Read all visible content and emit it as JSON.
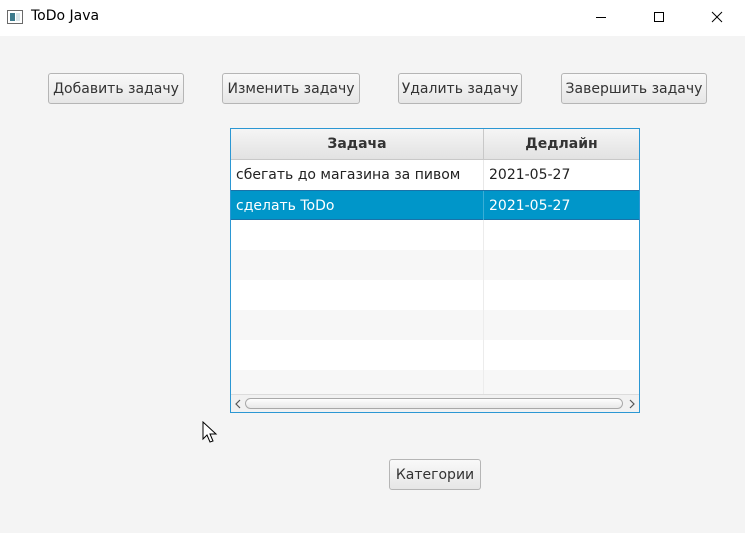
{
  "window": {
    "title": "ToDo Java"
  },
  "toolbar": {
    "add_label": "Добавить задачу",
    "edit_label": "Изменить задачу",
    "delete_label": "Удалить задачу",
    "complete_label": "Завершить задачу"
  },
  "table": {
    "columns": [
      "Задача",
      "Дедлайн"
    ],
    "rows": [
      {
        "task": "сбегать до магазина за пивом",
        "deadline": "2021-05-27",
        "selected": false
      },
      {
        "task": "сделать ToDo",
        "deadline": "2021-05-27",
        "selected": true
      }
    ],
    "empty_rows": 6
  },
  "footer": {
    "categories_label": "Категории"
  },
  "colors": {
    "selection": "#0096c9",
    "focus_border": "#2b97d3",
    "background": "#f4f4f4"
  },
  "icons": {
    "window_controls": [
      "minimize-icon",
      "maximize-icon",
      "close-icon"
    ],
    "scrollbar": [
      "chevron-left-icon",
      "chevron-right-icon"
    ],
    "pointer": "mouse-cursor-icon"
  }
}
